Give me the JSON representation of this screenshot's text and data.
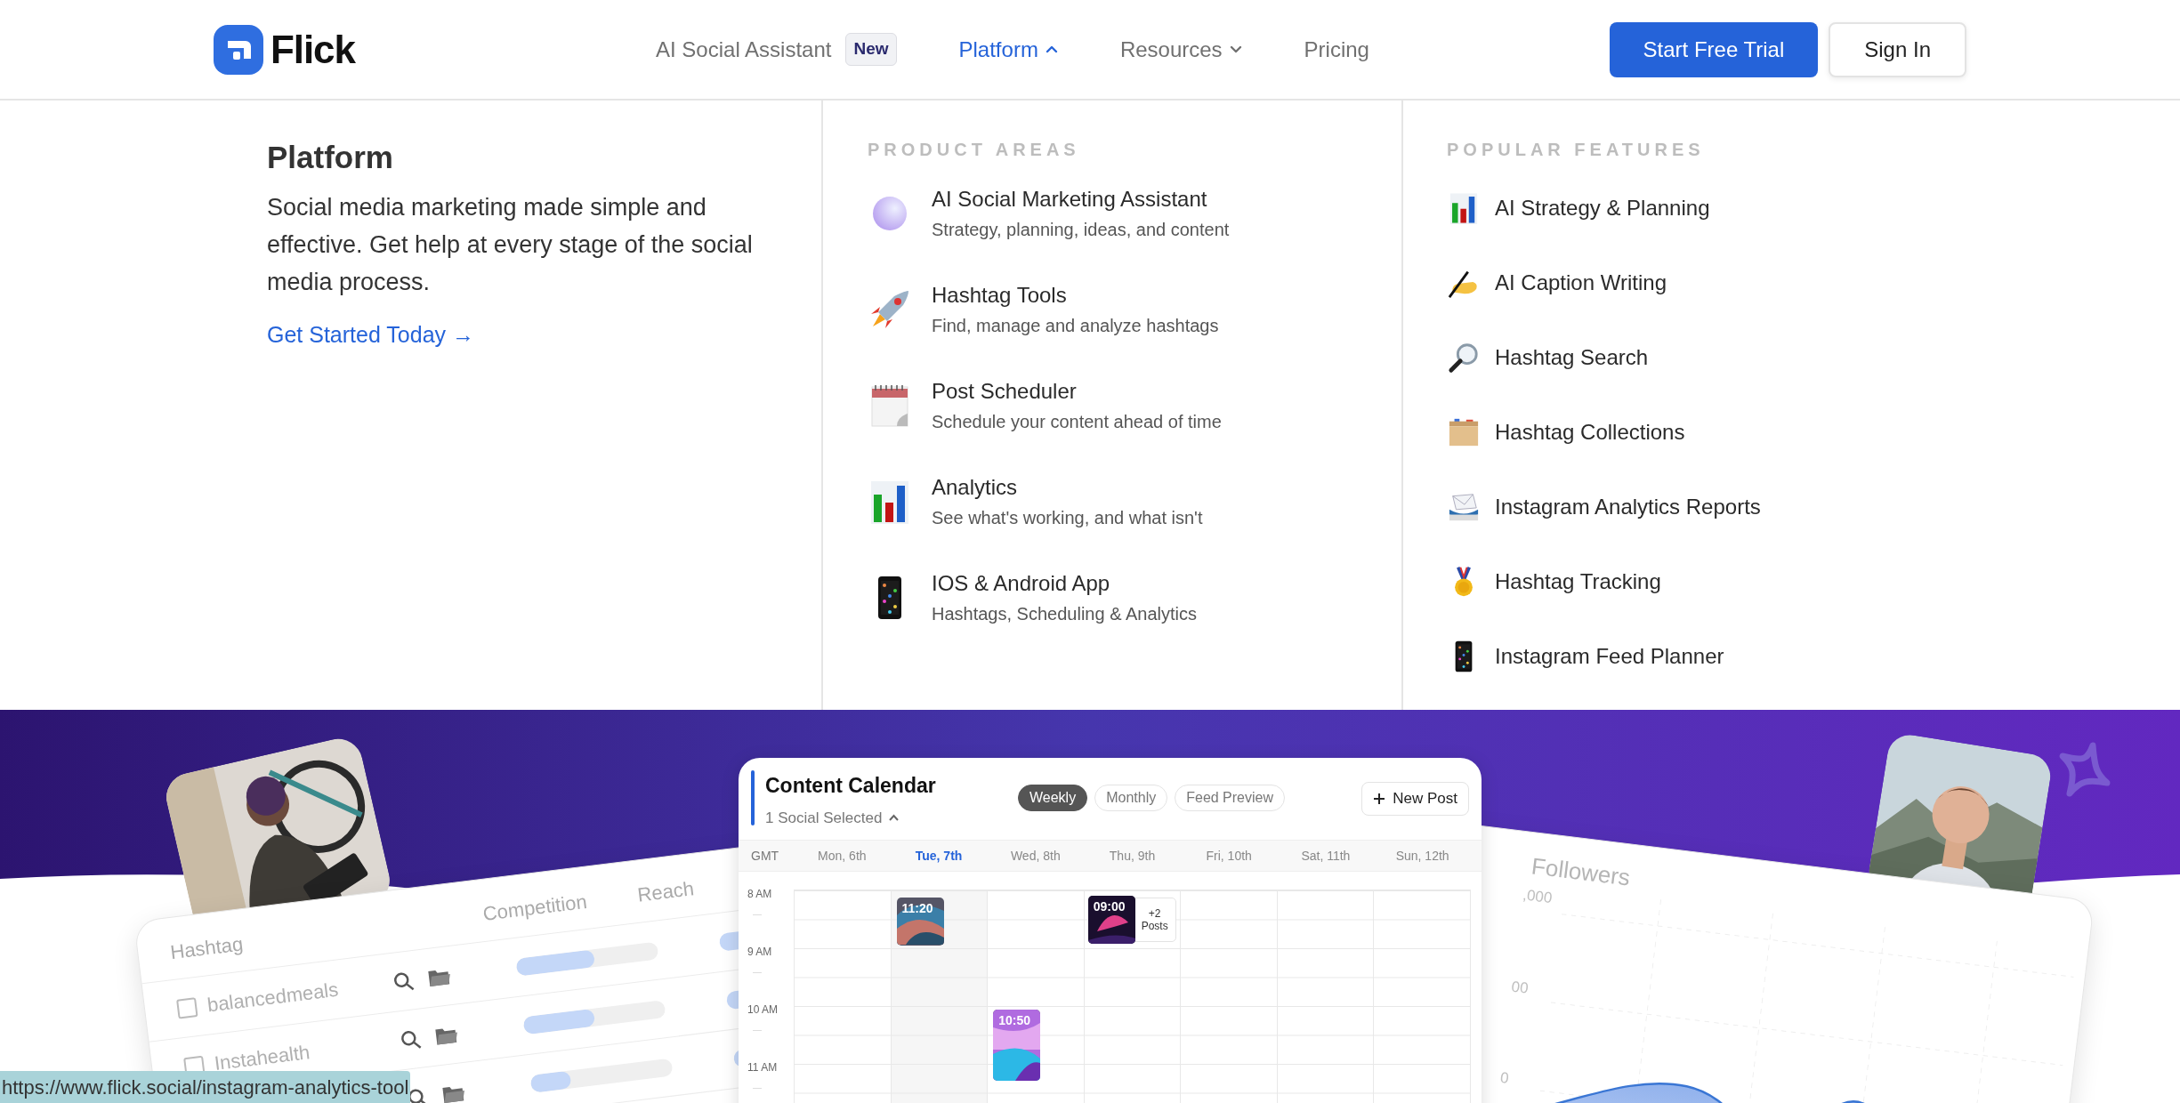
{
  "header": {
    "logo": "Flick",
    "nav": [
      {
        "label": "AI Social Assistant",
        "badge": "New",
        "selected": false
      },
      {
        "label": "Platform",
        "selected": true,
        "expanded": true
      },
      {
        "label": "Resources",
        "selected": false,
        "expanded": false
      },
      {
        "label": "Pricing",
        "selected": false
      }
    ],
    "buttons": [
      {
        "label": "Start Free Trial",
        "kind": "primary"
      },
      {
        "label": "Sign In",
        "kind": "secondary"
      }
    ]
  },
  "menu": {
    "title": "Platform",
    "description": "Social media marketing made simple and effective. Get help at every stage of the social media process.",
    "cta": "Get Started Today",
    "cta_arrow": "→",
    "product_areas": {
      "heading": "PRODUCT AREAS",
      "items": [
        {
          "title": "AI Social Marketing Assistant",
          "description": "Strategy, planning, ideas, and content"
        },
        {
          "title": "Hashtag Tools",
          "description": "Find, manage and analyze hashtags"
        },
        {
          "title": "Post Scheduler",
          "description": "Schedule your content ahead of time"
        },
        {
          "title": "Analytics",
          "description": "See what's working, and what isn't"
        },
        {
          "title": "IOS & Android App",
          "description": "Hashtags, Scheduling & Analytics"
        }
      ]
    },
    "popular_features": {
      "heading": "POPULAR FEATURES",
      "items": [
        {
          "label": "AI Strategy & Planning"
        },
        {
          "label": "AI Caption Writing"
        },
        {
          "label": "Hashtag Search"
        },
        {
          "label": "Hashtag Collections"
        },
        {
          "label": "Instagram Analytics Reports"
        },
        {
          "label": "Hashtag Tracking"
        },
        {
          "label": "Instagram Feed Planner"
        }
      ]
    }
  },
  "hero": {
    "hashtag_table": {
      "columns": [
        "Hashtag",
        "Competition",
        "Reach"
      ],
      "rows": [
        {
          "name": "balancedmeals",
          "checked": false,
          "level": 0.55
        },
        {
          "name": "Instahealth",
          "checked": false,
          "level": 0.5
        },
        {
          "level": 0.28
        }
      ]
    },
    "calendar": {
      "title": "Content Calendar",
      "subtitle": "1 Social Selected",
      "views": [
        {
          "label": "Weekly",
          "selected": true
        },
        {
          "label": "Monthly",
          "selected": false
        },
        {
          "label": "Feed Preview",
          "selected": false
        }
      ],
      "new_post": "New Post",
      "timezone": "GMT",
      "days": [
        {
          "label": "Mon, 6th",
          "selected": false
        },
        {
          "label": "Tue, 7th",
          "selected": true,
          "posts": [
            {
              "time": "11:20"
            }
          ]
        },
        {
          "label": "Wed, 8th",
          "selected": false,
          "posts": [
            {
              "time": "10:50"
            }
          ]
        },
        {
          "label": "Thu, 9th",
          "selected": false,
          "posts": [
            {
              "time": "09:00",
              "more": "+2 Posts"
            }
          ]
        },
        {
          "label": "Fri, 10th",
          "selected": false
        },
        {
          "label": "Sat, 11th",
          "selected": false
        },
        {
          "label": "Sun, 12th",
          "selected": false
        }
      ],
      "times": [
        "8 AM",
        "9 AM",
        "10 AM",
        "11 AM"
      ]
    },
    "followers": {
      "title": "Followers",
      "tick_labels": [
        ",000",
        "00",
        "0"
      ]
    }
  },
  "status_bar": {
    "url": "https://www.flick.social/instagram-analytics-tool"
  }
}
